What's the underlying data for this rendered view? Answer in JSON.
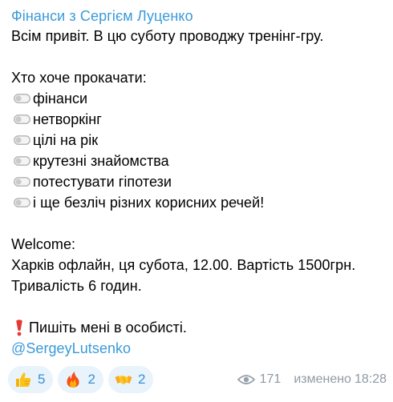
{
  "channel": {
    "name": "Фінанси з Сергієм Луценко"
  },
  "message": {
    "greeting": "Всім привіт. В цю суботу проводжу тренінг-гру.",
    "question": "Хто хоче прокачати:",
    "bullets": [
      "фінанси",
      "нетворкінг",
      "цілі на рік",
      "крутезні знайомства",
      "потестувати гіпотези",
      "і ще безліч різних корисних речей!"
    ],
    "welcome_title": "Welcome:",
    "details_line1": "Харків офлайн, ця субота, 12.00. Вартість 1500грн.",
    "details_line2": "Тривалість 6 годин.",
    "cta": "Пишіть мені в особисті.",
    "mention": "@SergeyLutsenko",
    "bullet_icon": "toggle-icon",
    "cta_icon": "red-exclamation-icon"
  },
  "reactions": [
    {
      "emoji": "thumbs-up-icon",
      "count": "5"
    },
    {
      "emoji": "fire-icon",
      "count": "2"
    },
    {
      "emoji": "handshake-icon",
      "count": "2"
    }
  ],
  "meta": {
    "views": "171",
    "edited_label": "изменено",
    "time": "18:28",
    "views_icon": "eye-icon"
  },
  "colors": {
    "accent": "#3a9ad9",
    "reaction_bg": "#e8f3fb",
    "meta_text": "#8f9aa5"
  }
}
